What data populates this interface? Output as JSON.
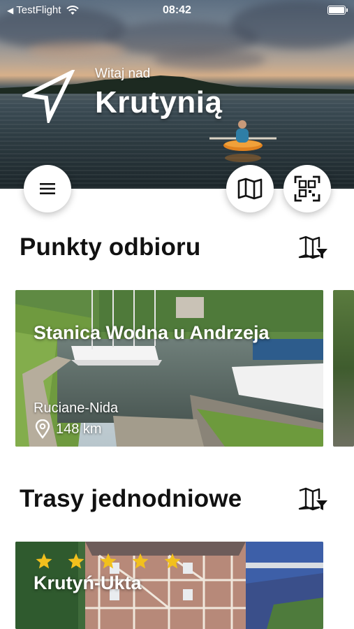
{
  "status_bar": {
    "back_app": "TestFlight",
    "time": "08:42"
  },
  "header": {
    "welcome_small": "Witaj nad",
    "welcome_big": "Krutynią"
  },
  "sections": {
    "pickup": {
      "title": "Punkty odbioru",
      "cards": [
        {
          "title": "Stanica Wodna u Andrzeja",
          "location": "Ruciane-Nida",
          "distance": "148 km"
        }
      ]
    },
    "day_routes": {
      "title": "Trasy jednodniowe",
      "cards": [
        {
          "title": "Krutyń-Ukta",
          "rating": 5
        }
      ]
    }
  },
  "icons": {
    "status": [
      "chevron-left-icon",
      "wifi-icon",
      "battery-icon"
    ],
    "header": "navigation-arrow-icon",
    "buttons": [
      "menu-icon",
      "map-icon",
      "qr-scan-icon"
    ],
    "sections": [
      "map-filter-icon",
      "location-pin-icon",
      "star-icon"
    ]
  },
  "colors": {
    "star": "#f2c01d",
    "background": "#ffffff",
    "text": "#111111"
  }
}
